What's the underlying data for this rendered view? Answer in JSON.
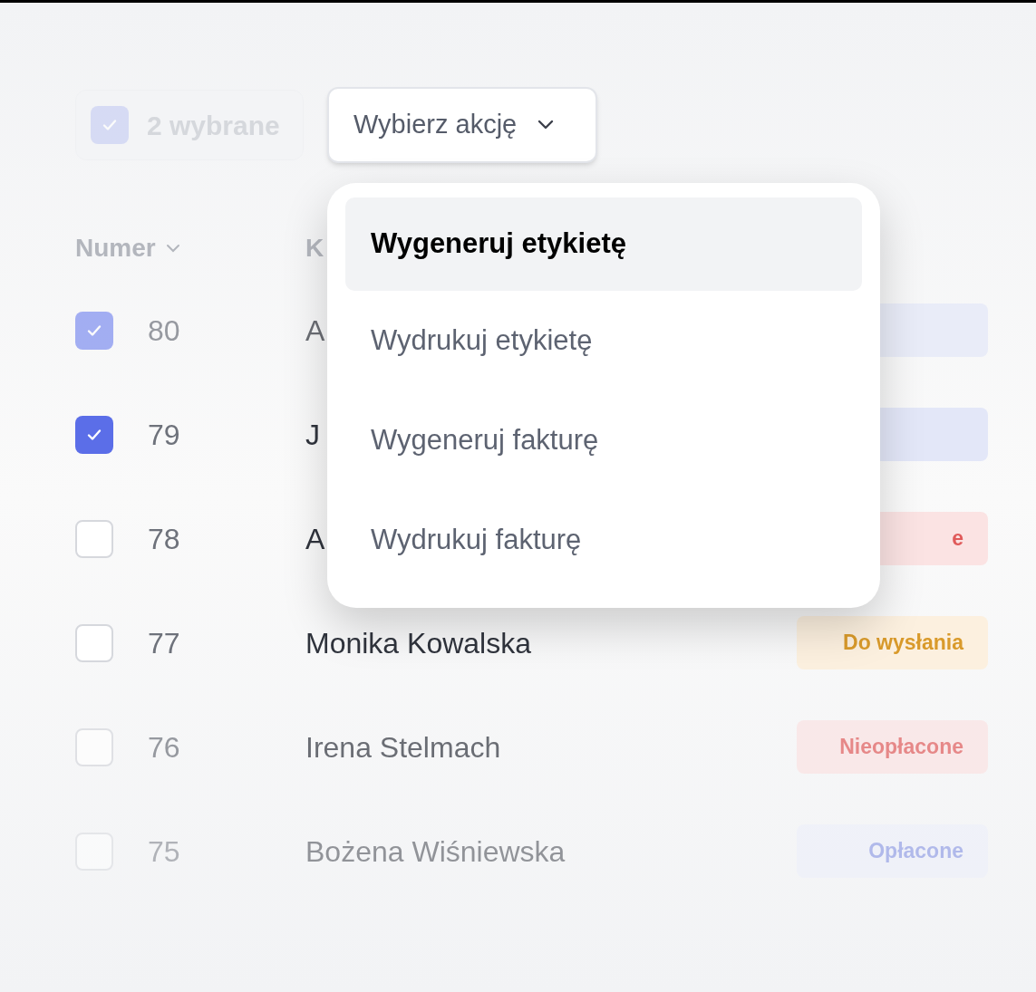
{
  "selection": {
    "label": "2 wybrane",
    "checked": true
  },
  "action_dropdown": {
    "label": "Wybierz akcję",
    "expanded": true,
    "options": [
      {
        "label": "Wygeneruj etykietę",
        "selected": true
      },
      {
        "label": "Wydrukuj etykietę",
        "selected": false
      },
      {
        "label": "Wygeneruj fakturę",
        "selected": false
      },
      {
        "label": "Wydrukuj fakturę",
        "selected": false
      }
    ]
  },
  "table": {
    "columns": [
      {
        "label": "Numer"
      },
      {
        "label": "K"
      }
    ],
    "rows": [
      {
        "checked": true,
        "number": "80",
        "name": "A",
        "status": "",
        "color": "#e3e7f8"
      },
      {
        "checked": true,
        "number": "79",
        "name": "J",
        "status": "",
        "color": "#e3e7f8"
      },
      {
        "checked": false,
        "number": "78",
        "name": "A",
        "status": "e",
        "color": "#fbe3e3"
      },
      {
        "checked": false,
        "number": "77",
        "name": "Monika Kowalska",
        "status": "Do wysłania",
        "color": "#fcf0df"
      },
      {
        "checked": false,
        "number": "76",
        "name": "Irena Stelmach",
        "status": "Nieopłacone",
        "color": "#fbe3e3"
      },
      {
        "checked": false,
        "number": "75",
        "name": "Bożena Wiśniewska",
        "status": "Opłacone",
        "color": "#eceffb"
      }
    ]
  }
}
